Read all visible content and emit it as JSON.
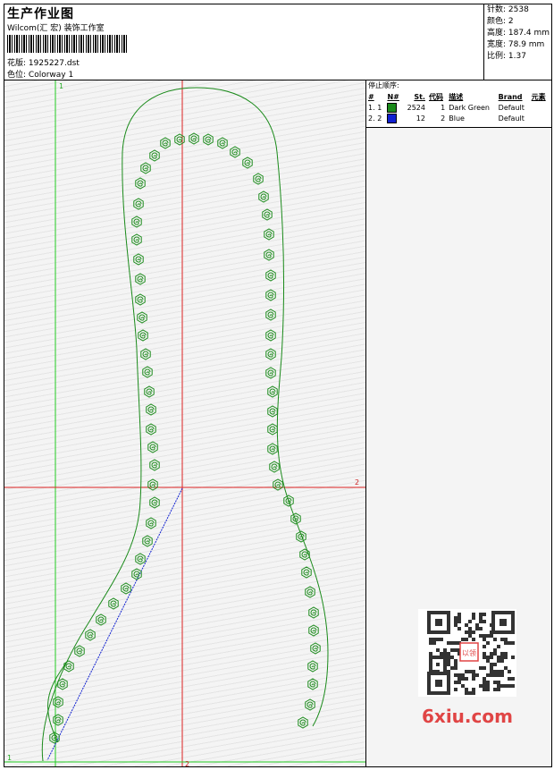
{
  "header": {
    "title": "生产作业图",
    "company": "Wilcom(汇 宏) 装饰工作室",
    "design_label": "花版:",
    "design_value": "1925227.dst",
    "colorway_label": "色位:",
    "colorway_value": "Colorway 1"
  },
  "stats": {
    "stitches": "针数: 2538",
    "colors": "颜色: 2",
    "height": "高度: 187.4 mm",
    "width": "宽度: 78.9 mm",
    "scale": "比例: 1.37"
  },
  "guides": {
    "v1_label": "1",
    "v2_label": "2",
    "h2_label": "2",
    "h1_label": "1"
  },
  "stop_sequence": {
    "title": "停止顺序:",
    "headers": [
      "#",
      "N#",
      "St.",
      "代码",
      "描述",
      "Brand",
      "元素"
    ],
    "rows": [
      {
        "idx": "1.",
        "n": "1",
        "color": "#1a8a1a",
        "stitches": "2524",
        "code": "1",
        "desc": "Dark Green",
        "brand": "Default",
        "elem": ""
      },
      {
        "idx": "2.",
        "n": "2",
        "color": "#1020d0",
        "stitches": "12",
        "code": "2",
        "desc": "Blue",
        "brand": "Default",
        "elem": ""
      }
    ]
  },
  "watermark": {
    "text": "6xiu.com",
    "seal": "以领"
  }
}
